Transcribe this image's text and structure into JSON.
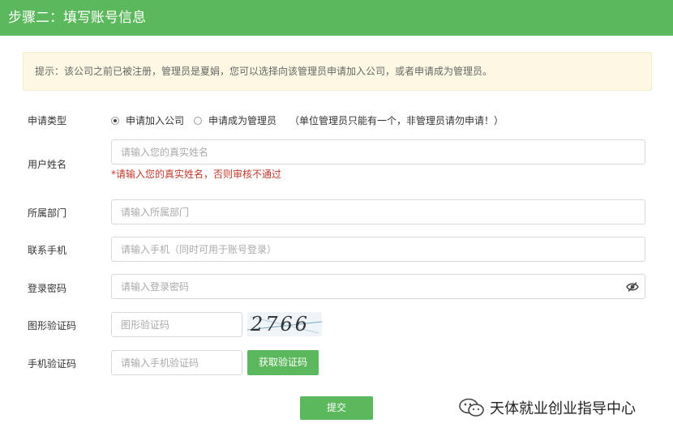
{
  "header": {
    "title": "步骤二：填写账号信息"
  },
  "notice": {
    "text": "提示：该公司之前已被注册，管理员是夏娟，您可以选择向该管理员申请加入公司，或者申请成为管理员。"
  },
  "form": {
    "apply_type": {
      "label": "申请类型",
      "options": [
        "申请加入公司",
        "申请成为管理员"
      ],
      "selected": "申请加入公司",
      "note": "（单位管理员只能有一个，非管理员请勿申请！）"
    },
    "name": {
      "label": "用户姓名",
      "placeholder": "请输入您的真实姓名",
      "hint": "*请输入您的真实姓名，否则审核不通过"
    },
    "department": {
      "label": "所属部门",
      "placeholder": "请输入所属部门"
    },
    "phone": {
      "label": "联系手机",
      "placeholder": "请输入手机（同时可用于账号登录）"
    },
    "password": {
      "label": "登录密码",
      "placeholder": "请输入登录密码"
    },
    "captcha": {
      "label": "图形验证码",
      "placeholder": "图形验证码",
      "image_text": "2766"
    },
    "sms_code": {
      "label": "手机验证码",
      "placeholder": "请输入手机验证码",
      "button": "获取验证码"
    },
    "submit": "提交"
  },
  "watermark": {
    "text": "天体就业创业指导中心"
  },
  "colors": {
    "primary": "#5cb85c",
    "notice_bg": "#fcf8e3",
    "error": "#c0392b"
  }
}
